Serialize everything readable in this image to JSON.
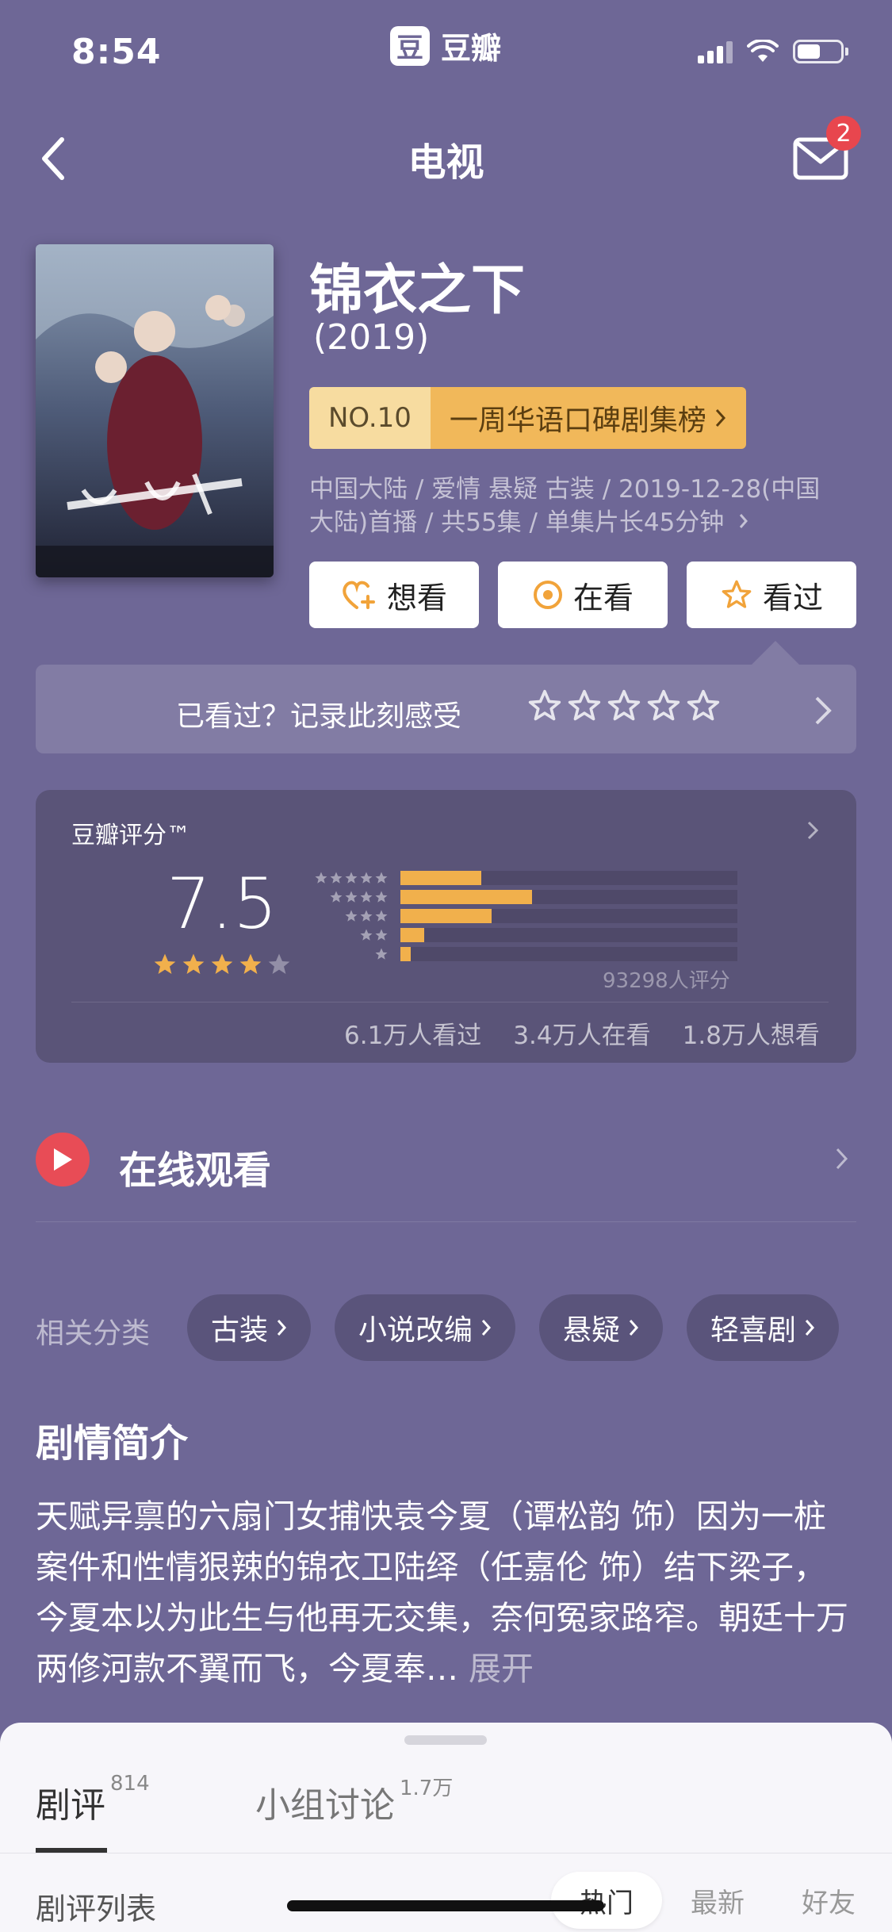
{
  "status_bar": {
    "time": "8:54",
    "app_logo_glyph": "豆",
    "app_name": "豆瓣"
  },
  "nav": {
    "title": "电视",
    "badge_count": "2"
  },
  "show": {
    "title": "锦衣之下",
    "year": "(2019)",
    "rank_no": "NO.10",
    "rank_label": "一周华语口碑剧集榜",
    "meta_line1": "中国大陆 / 爱情 悬疑 古装 / 2019-12-28(中国",
    "meta_line2": "大陆)首播 / 共55集 / 单集片长45分钟"
  },
  "actions": {
    "want": "想看",
    "watching": "在看",
    "watched": "看过"
  },
  "record": {
    "prompt": "已看过？记录此刻感受",
    "star_count": 5
  },
  "rating": {
    "label": "豆瓣评分™",
    "score": "7.5",
    "stars_filled": 4,
    "star_count": 5,
    "distribution": [
      0.24,
      0.39,
      0.27,
      0.07,
      0.03
    ],
    "count_text": "93298人评分",
    "watched": "6.1万人看过",
    "watching": "3.4万人在看",
    "want": "1.8万人想看"
  },
  "watch_online": {
    "label": "在线观看"
  },
  "tags": {
    "label": "相关分类",
    "items": [
      "古装",
      "小说改编",
      "悬疑",
      "轻喜剧"
    ]
  },
  "synopsis": {
    "title": "剧情简介",
    "text": "天赋异禀的六扇门女捕快袁今夏（谭松韵 饰）因为一桩案件和性情狠辣的锦衣卫陆绎（任嘉伦 饰）结下梁子，今夏本以为此生与他再无交集，奈何冤家路窄。朝廷十万两修河款不翼而飞，今夏奉…",
    "more": "展开"
  },
  "sheet": {
    "tab_reviews": "剧评",
    "tab_reviews_count": "814",
    "tab_groups": "小组讨论",
    "tab_groups_count": "1.7万",
    "list_label": "剧评列表",
    "sort_hot": "热门",
    "sort_new": "最新",
    "sort_friends": "好友"
  },
  "colors": {
    "background": "#6e6796",
    "accent_star": "#f1b04c",
    "badge": "#e8464e",
    "play": "#e84c56"
  }
}
